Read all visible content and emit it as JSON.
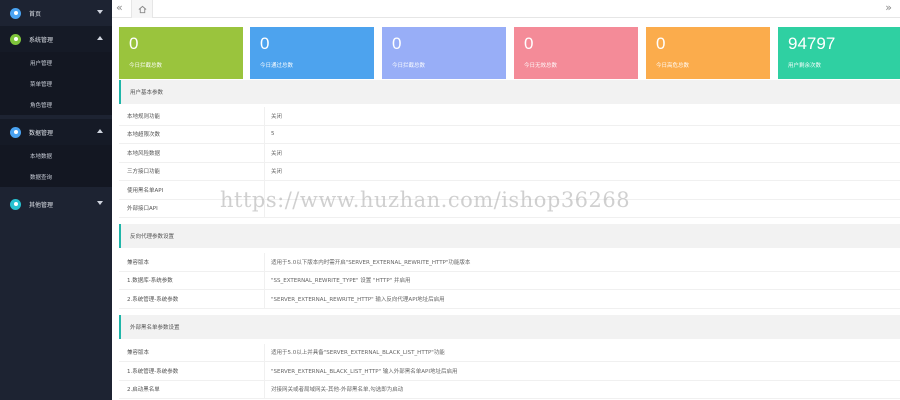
{
  "sidebar": {
    "groups": [
      {
        "label": "首页",
        "color": "#4aa3f2",
        "icon": "home-icon",
        "expanded": false,
        "items": []
      },
      {
        "label": "系统管理",
        "color": "#7ec43b",
        "icon": "settings-icon",
        "expanded": true,
        "items": [
          "用户管理",
          "菜单管理",
          "角色管理"
        ]
      },
      {
        "label": "数据管理",
        "color": "#4aa3f2",
        "icon": "database-icon",
        "expanded": true,
        "items": [
          "本地数据",
          "数据查询"
        ]
      },
      {
        "label": "其他管理",
        "color": "#28c1d0",
        "icon": "grid-icon",
        "expanded": false,
        "items": []
      }
    ]
  },
  "tabbar": {
    "prev": "«",
    "next": "»",
    "home_icon": "home-icon"
  },
  "cards": [
    {
      "value": "0",
      "caption": "今日拦截总数",
      "color": "#9ac43d"
    },
    {
      "value": "0",
      "caption": "今日通过总数",
      "color": "#4da3ee"
    },
    {
      "value": "0",
      "caption": "今日拦截总数",
      "color": "#98aef7"
    },
    {
      "value": "0",
      "caption": "今日无效总数",
      "color": "#f48b98"
    },
    {
      "value": "0",
      "caption": "今日高危总数",
      "color": "#fbac4c"
    },
    {
      "value": "94797",
      "caption": "用户剩余次数",
      "color": "#2fd0a2"
    }
  ],
  "section1": {
    "title": "用户基本参数",
    "rows": [
      {
        "k": "本地规则功能",
        "v": "关闭"
      },
      {
        "k": "本地超限次数",
        "v": "5"
      },
      {
        "k": "本地风险数据",
        "v": "关闭"
      },
      {
        "k": "三方接口功能",
        "v": "关闭"
      },
      {
        "k": "使用黑名单API",
        "v": ""
      },
      {
        "k": "外部接口API",
        "v": ""
      }
    ]
  },
  "section2": {
    "title": "反向代理参数设置",
    "rows": [
      {
        "k": "兼容版本",
        "v": "适用于5.0以下版本内时需开启\"SERVER_EXTERNAL_REWRITE_HTTP\"功能版本"
      },
      {
        "k": "1.数据库-系统参数",
        "v": "\"SS_EXTERNAL_REWRITE_TYPE\" 设置 \"HTTP\" 并启用"
      },
      {
        "k": "2.系统管理-系统参数",
        "v": "\"SERVER_EXTERNAL_REWRITE_HTTP\" 输入反向代理API地址后启用"
      }
    ]
  },
  "section3": {
    "title": "外部黑名单参数设置",
    "rows": [
      {
        "k": "兼容版本",
        "v": "适用于5.0以上并具备\"SERVER_EXTERNAL_BLACK_LIST_HTTP\"功能"
      },
      {
        "k": "1.系统管理-系统参数",
        "v": "\"SERVER_EXTERNAL_BLACK_LIST_HTTP\" 输入外部黑名单API地址后启用"
      },
      {
        "k": "2.启动黑名单",
        "v": "对接网关或者局域网关-其他-外部黑名单,勾选即为启动"
      }
    ]
  },
  "watermark": "https://www.huzhan.com/ishop36268"
}
